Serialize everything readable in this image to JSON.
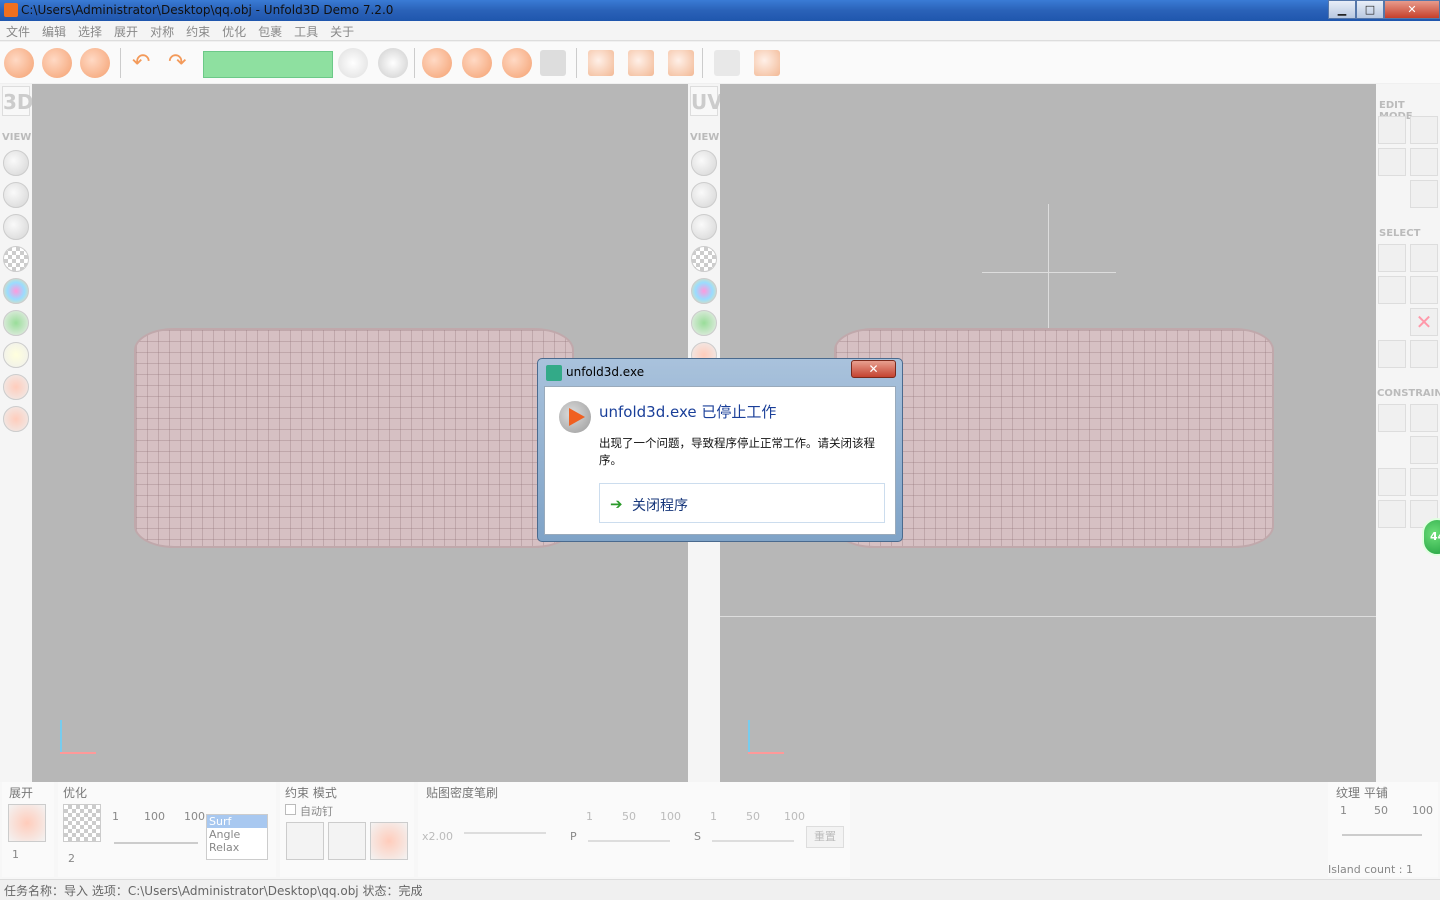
{
  "window": {
    "title": "C:\\Users\\Administrator\\Desktop\\qq.obj - Unfold3D Demo  7.2.0",
    "minimize": "▁",
    "maximize": "□",
    "close": "✕"
  },
  "menu": [
    "文件",
    "编辑",
    "选择",
    "展开",
    "对称",
    "约束",
    "优化",
    "包裹",
    "工具",
    "关于"
  ],
  "left_strip": {
    "label_3d": "3D",
    "label_uv": "UV",
    "view": "VIEW"
  },
  "right_panel": {
    "edit_mode": "EDIT MODE",
    "select": "SELECT",
    "constrain": "CONSTRAIN"
  },
  "bottom": {
    "unfold": {
      "label": "展开",
      "spinner_value": "1"
    },
    "optimize": {
      "label": "优化",
      "spinner_value": "2",
      "scale": [
        "1",
        "100",
        "100"
      ],
      "list": [
        "Surf",
        "Angle",
        "Relax"
      ]
    },
    "constraint": {
      "label": "约束 模式",
      "auto_pin": "自动钉"
    },
    "density": {
      "label": "贴图密度笔刷",
      "value": "x2.00",
      "p_label": "P",
      "s_label": "S",
      "p_scale": [
        "1",
        "50",
        "100"
      ],
      "s_scale": [
        "1",
        "50",
        "100"
      ],
      "reset": "重置"
    },
    "texture": {
      "label": "纹理 平铺",
      "scale": [
        "1",
        "50",
        "100"
      ],
      "island_count": "Island count : 1"
    }
  },
  "status": "任务名称：导入    选项：C:\\Users\\Administrator\\Desktop\\qq.obj    状态：完成",
  "dialog": {
    "title": "unfold3d.exe",
    "close": "✕",
    "heading": "unfold3d.exe 已停止工作",
    "message": "出现了一个问题，导致程序停止正常工作。请关闭该程序。",
    "action": "关闭程序",
    "action_icon": "➔"
  },
  "badge": "44"
}
